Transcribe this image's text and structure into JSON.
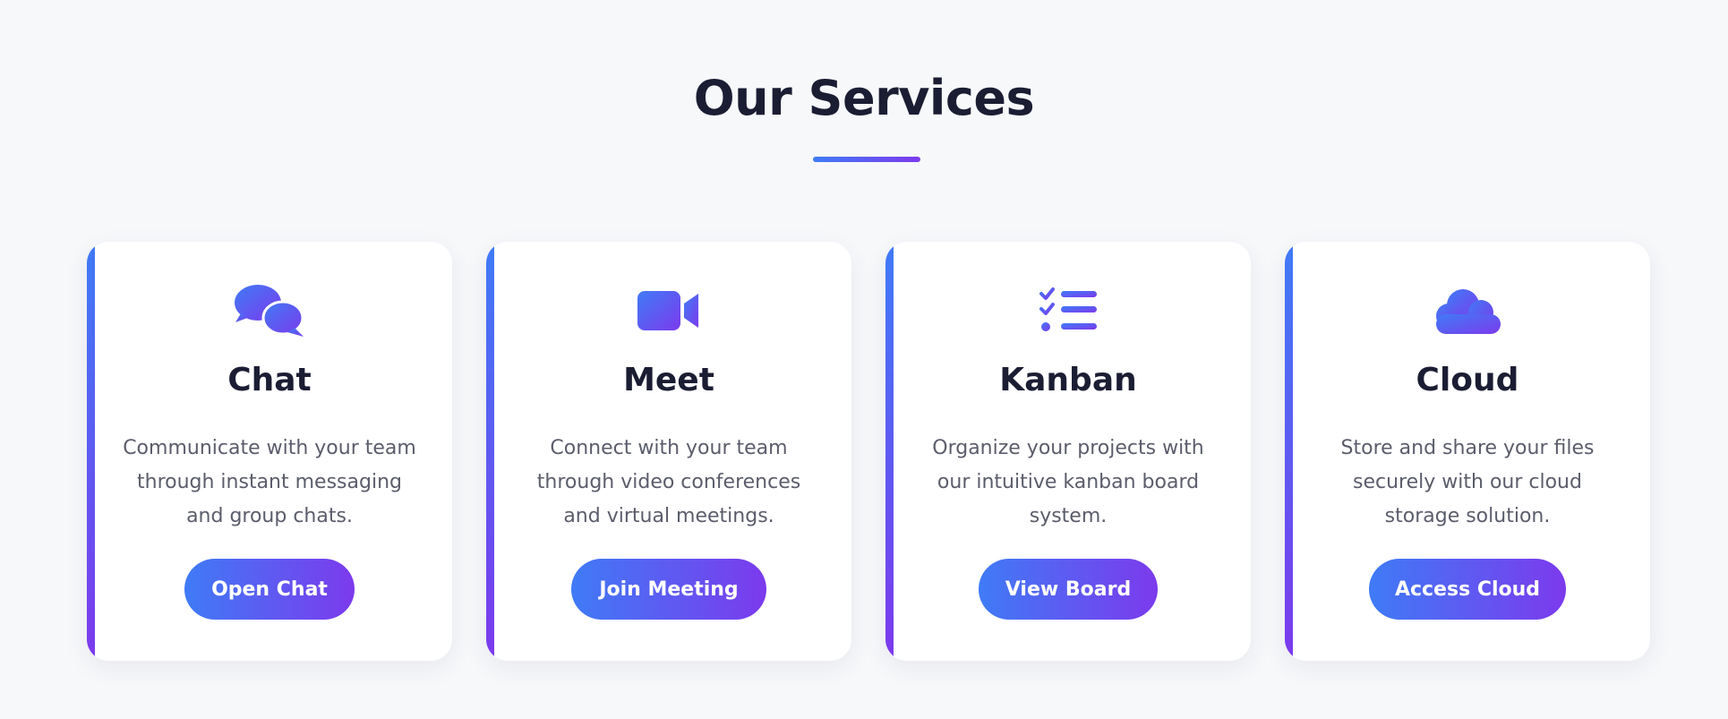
{
  "section": {
    "title": "Our Services"
  },
  "colors": {
    "accent_start": "#3f7bf6",
    "accent_end": "#7c3aed",
    "page_background": "#f7f8fa",
    "card_background": "#ffffff",
    "heading": "#1b1d33",
    "body_text": "#5b5d6b"
  },
  "services": [
    {
      "icon": "chat-bubbles-icon",
      "title": "Chat",
      "description": "Communicate with your team through instant messaging and group chats.",
      "button_label": "Open Chat"
    },
    {
      "icon": "video-camera-icon",
      "title": "Meet",
      "description": "Connect with your team through video conferences and virtual meetings.",
      "button_label": "Join Meeting"
    },
    {
      "icon": "task-list-icon",
      "title": "Kanban",
      "description": "Organize your projects with our intuitive kanban board system.",
      "button_label": "View Board"
    },
    {
      "icon": "cloud-icon",
      "title": "Cloud",
      "description": "Store and share your files securely with our cloud storage solution.",
      "button_label": "Access Cloud"
    }
  ]
}
